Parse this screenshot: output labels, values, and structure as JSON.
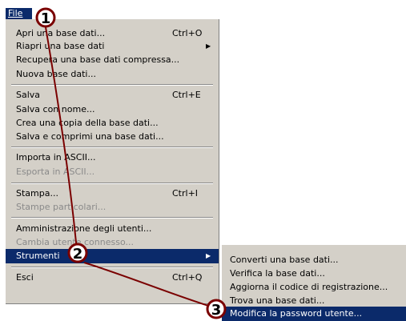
{
  "menubar": {
    "file_label": "File"
  },
  "file_menu": {
    "items": [
      {
        "label": "Apri una base dati...",
        "shortcut": "Ctrl+O"
      },
      {
        "label": "Riapri una base dati"
      },
      {
        "label": "Recupera una base dati compressa..."
      },
      {
        "label": "Nuova base dati..."
      },
      {
        "label": "Salva",
        "shortcut": "Ctrl+E"
      },
      {
        "label": "Salva con nome..."
      },
      {
        "label": "Crea una copia della base dati..."
      },
      {
        "label": "Salva e comprimi una base dati..."
      },
      {
        "label": "Importa in ASCII..."
      },
      {
        "label": "Esporta in ASCII..."
      },
      {
        "label": "Stampa...",
        "shortcut": "Ctrl+I"
      },
      {
        "label": "Stampe particolari..."
      },
      {
        "label": "Amministrazione degli utenti..."
      },
      {
        "label": "Cambia utente connesso..."
      },
      {
        "label": "Strumenti"
      },
      {
        "label": "Esci",
        "shortcut": "Ctrl+Q"
      }
    ]
  },
  "tools_submenu": {
    "items": [
      {
        "label": "Converti una base dati..."
      },
      {
        "label": "Verifica la base dati..."
      },
      {
        "label": "Aggiorna il codice di registrazione..."
      },
      {
        "label": "Trova una base dati..."
      },
      {
        "label": "Modifica la password utente..."
      }
    ]
  },
  "callouts": {
    "one": "1",
    "two": "2",
    "three": "3",
    "color": "#7a0000"
  }
}
